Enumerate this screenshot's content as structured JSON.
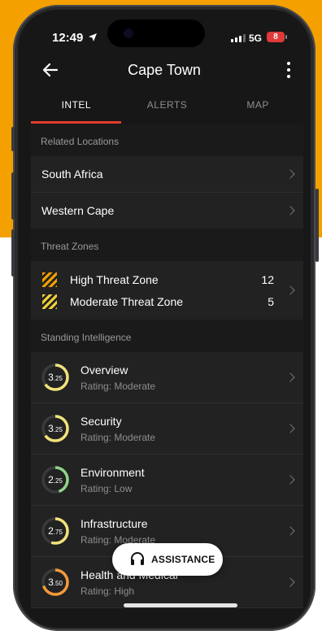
{
  "status": {
    "time": "12:49",
    "network": "5G",
    "battery": "8"
  },
  "header": {
    "title": "Cape Town"
  },
  "tabs": [
    {
      "label": "INTEL"
    },
    {
      "label": "ALERTS"
    },
    {
      "label": "MAP"
    }
  ],
  "related": {
    "header": "Related Locations",
    "items": [
      {
        "label": "South Africa"
      },
      {
        "label": "Western Cape"
      }
    ]
  },
  "zones": {
    "header": "Threat Zones",
    "items": [
      {
        "label": "High Threat Zone",
        "count": "12",
        "color": "#f3a000"
      },
      {
        "label": "Moderate Threat Zone",
        "count": "5",
        "color": "#f2d03a"
      }
    ]
  },
  "intel": {
    "header": "Standing Intelligence",
    "items": [
      {
        "title": "Overview",
        "rating": "Rating: Moderate",
        "score_int": "3",
        "score_dec": ".25",
        "value": 3.25,
        "color": "#f2e27a"
      },
      {
        "title": "Security",
        "rating": "Rating: Moderate",
        "score_int": "3",
        "score_dec": ".25",
        "value": 3.25,
        "color": "#f2e27a"
      },
      {
        "title": "Environment",
        "rating": "Rating: Low",
        "score_int": "2",
        "score_dec": ".25",
        "value": 2.25,
        "color": "#8fd48a"
      },
      {
        "title": "Infrastructure",
        "rating": "Rating: Moderate",
        "score_int": "2",
        "score_dec": ".75",
        "value": 2.75,
        "color": "#f2e27a"
      },
      {
        "title": "Health and Medical",
        "rating": "Rating: High",
        "score_int": "3",
        "score_dec": ".50",
        "value": 3.5,
        "color": "#f39a3a"
      }
    ]
  },
  "assistance": {
    "label": "ASSISTANCE"
  }
}
